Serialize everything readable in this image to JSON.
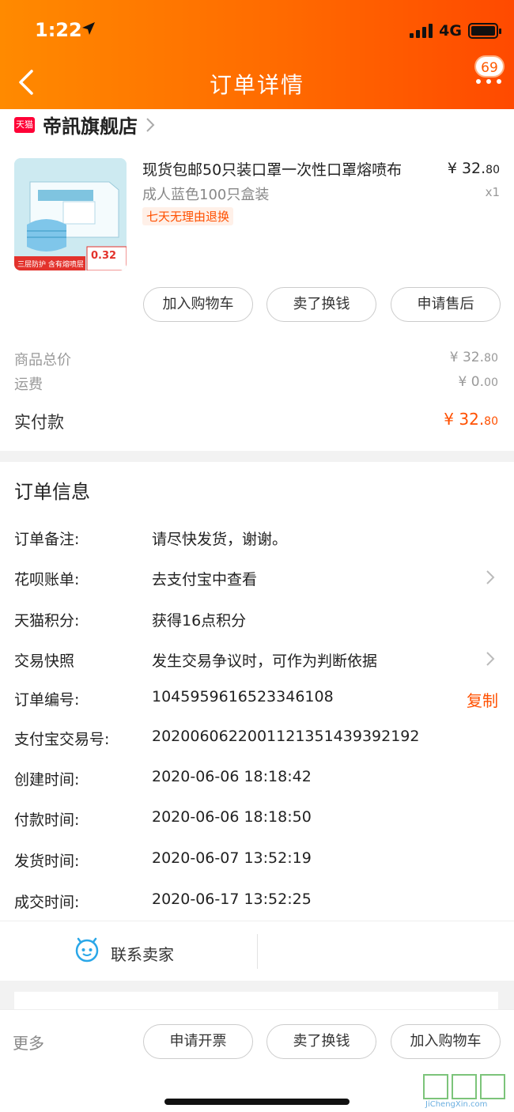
{
  "status_bar": {
    "time": "1:22",
    "network": "4G"
  },
  "header": {
    "title": "订单详情",
    "notification_count": "69"
  },
  "shop": {
    "logo_text": "天猫",
    "name": "帝訊旗舰店"
  },
  "product": {
    "title": "现货包邮50只装口罩一次性口罩熔喷布",
    "sku": "成人蓝色100只盒装",
    "return_tag": "七天无理由退换",
    "price_main": "¥ 32.",
    "price_cents": "80",
    "quantity": "x1",
    "image_banner": "三层防护 含有熔喷层",
    "image_price": "0.32"
  },
  "actions": {
    "add_cart": "加入购物车",
    "resell": "卖了换钱",
    "after_sale": "申请售后"
  },
  "summary": {
    "goods_total_label": "商品总价",
    "goods_total_main": "¥ 32.",
    "goods_total_cents": "80",
    "shipping_label": "运费",
    "shipping_main": "¥ 0.",
    "shipping_cents": "00",
    "paid_label": "实付款",
    "paid_main": "¥ 32.",
    "paid_cents": "80"
  },
  "order_info": {
    "title": "订单信息",
    "rows": [
      {
        "label": "订单备注:",
        "value": "请尽快发货，谢谢。"
      },
      {
        "label": "花呗账单:",
        "value": "去支付宝中查看"
      },
      {
        "label": "天猫积分:",
        "value": "获得16点积分"
      },
      {
        "label": "交易快照",
        "value": "发生交易争议时，可作为判断依据"
      },
      {
        "label": "订单编号:",
        "value": "1045959616523346108"
      },
      {
        "label": "支付宝交易号:",
        "value": "2020060622001121351439392192"
      },
      {
        "label": "创建时间:",
        "value": "2020-06-06 18:18:42"
      },
      {
        "label": "付款时间:",
        "value": "2020-06-06 18:18:50"
      },
      {
        "label": "发货时间:",
        "value": "2020-06-07 13:52:19"
      },
      {
        "label": "成交时间:",
        "value": "2020-06-17 13:52:25"
      }
    ],
    "copy_label": "复制"
  },
  "contact": {
    "label": "联系卖家"
  },
  "bottom": {
    "more": "更多",
    "invoice": "申请开票",
    "resell": "卖了换钱",
    "add_cart": "加入购物车"
  },
  "watermark": {
    "text": "JiChengXin.com"
  },
  "colors": {
    "accent": "#ff5000",
    "header_start": "#ff8a00",
    "header_end": "#ff4a00"
  }
}
